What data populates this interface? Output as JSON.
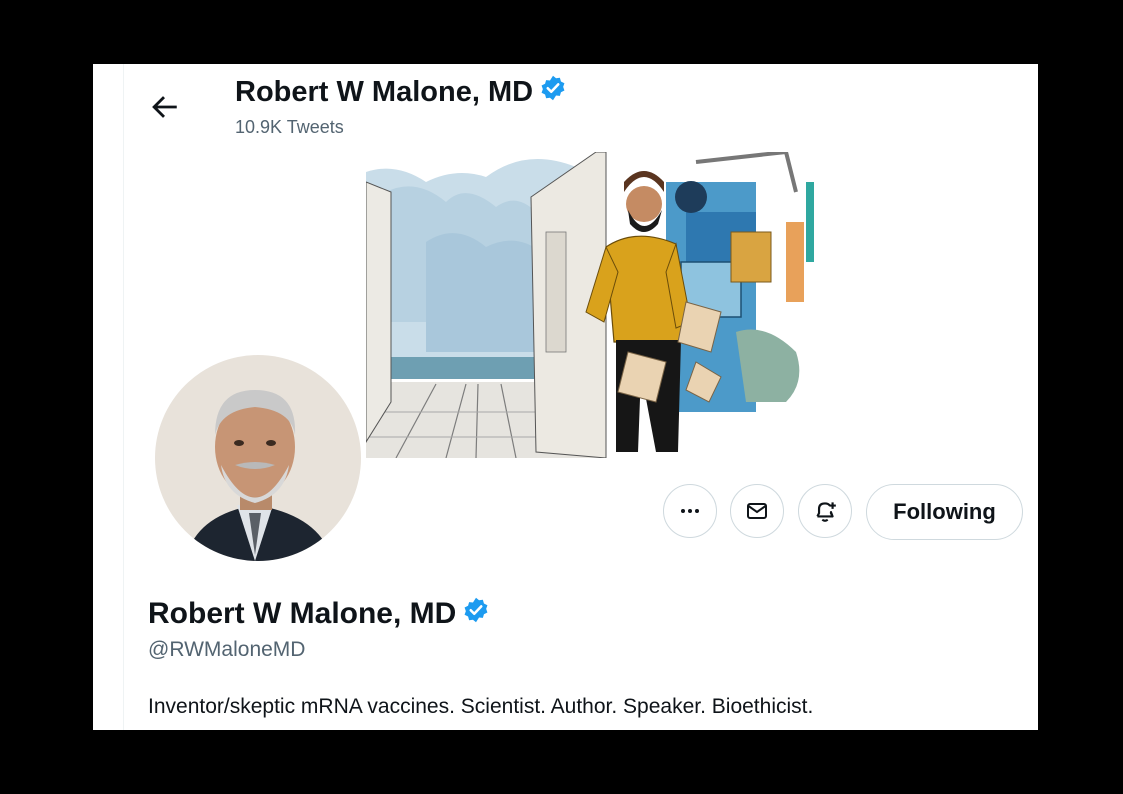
{
  "header": {
    "title": "Robert W Malone, MD",
    "tweet_count": "10.9K Tweets",
    "back_icon": "arrow-left-icon"
  },
  "profile": {
    "name": "Robert W Malone, MD",
    "handle": "@RWMaloneMD",
    "bio": "Inventor/skeptic mRNA vaccines. Scientist. Author. Speaker. Bioethicist.",
    "verified": true
  },
  "actions": {
    "more_icon": "more-horizontal-icon",
    "message_icon": "mail-icon",
    "notify_icon": "bell-plus-icon",
    "following_label": "Following"
  },
  "colors": {
    "accent": "#1d9bf0",
    "text": "#0f1419",
    "secondary": "#536471",
    "border": "#cfd9de"
  }
}
